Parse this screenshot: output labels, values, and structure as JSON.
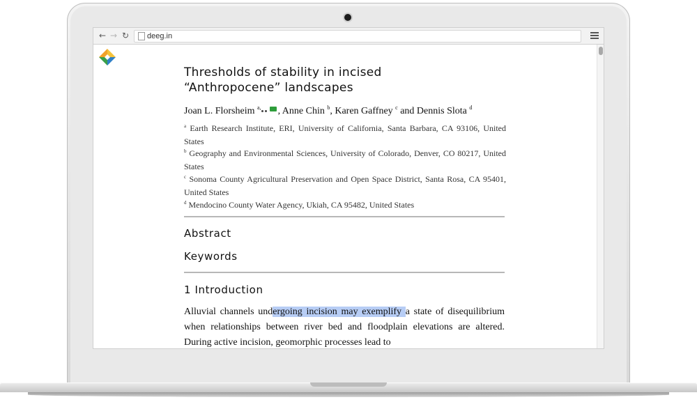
{
  "browser": {
    "url": "deeg.in"
  },
  "article": {
    "title_line1": "Thresholds of stability in incised",
    "title_line2": "“Anthropocene” landscapes",
    "authors": {
      "a1": "Joan L. Florsheim ",
      "a1_sup": "a,",
      "a2": ", Anne Chin ",
      "a2_sup": "b",
      "a3": ", Karen Gaffney ",
      "a3_sup": "c",
      "a4": " and Dennis Slota ",
      "a4_sup": "d"
    },
    "affiliations": [
      {
        "sup": "a",
        "text": "Earth Research Institute, ERI, University of California, Santa Barbara, CA 93106, United States"
      },
      {
        "sup": "b",
        "text": "Geography and Environmental Sciences, University of Colorado, Denver, CO 80217, United States"
      },
      {
        "sup": "c",
        "text": "Sonoma County Agricultural Preservation and Open Space District, Santa Rosa, CA 95401, United States"
      },
      {
        "sup": "d",
        "text": "Mendocino County Water Agency, Ukiah, CA 95482, United States"
      }
    ],
    "headings": {
      "abstract": "Abstract",
      "keywords": "Keywords",
      "introduction": "1 Introduction"
    },
    "intro": {
      "pre": "Alluvial channels und",
      "highlight": "ergoing incision may exemplify ",
      "post": "a state of disequilibrium when relationships between river bed and floodplain elevations are altered. During active incision, geomorphic processes lead to"
    }
  },
  "icons": {
    "back": "back-arrow-icon",
    "forward": "forward-arrow-icon",
    "reload": "reload-icon",
    "page": "page-icon",
    "menu": "hamburger-menu-icon",
    "logo": "deeg-logo-icon",
    "orcid": "orcid-icon",
    "email": "email-icon"
  },
  "colors": {
    "selection": "#b7cdf5",
    "logo_yellow": "#f5c33b",
    "logo_green": "#3aa04a",
    "logo_blue": "#2f80c8",
    "email_green": "#2e9d3b"
  }
}
